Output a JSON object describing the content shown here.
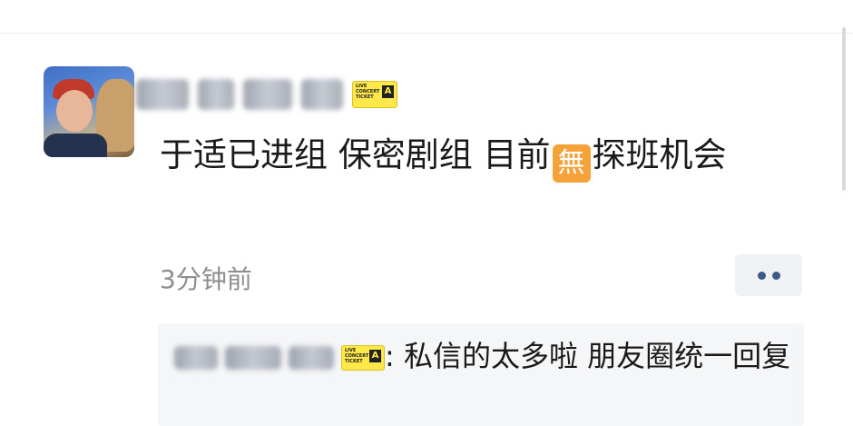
{
  "post": {
    "author_badge": {
      "lines": [
        "LIVE",
        "CONCERT",
        "TICKET"
      ],
      "letter": "A",
      "color": "#ffe94a"
    },
    "text_before_emoji": "于适已进组 保密剧组 目前",
    "emoji": "無",
    "text_after_emoji": "探班机会",
    "time": "3分钟前"
  },
  "comment": {
    "separator": ":",
    "text": "私信的太多啦 朋友圈统一回复"
  },
  "colors": {
    "link_blue": "#3b5a8a",
    "emoji_orange": "#f6a23a",
    "time_gray": "#8e8e8e"
  },
  "icons": {
    "more": "more-dots-icon"
  }
}
